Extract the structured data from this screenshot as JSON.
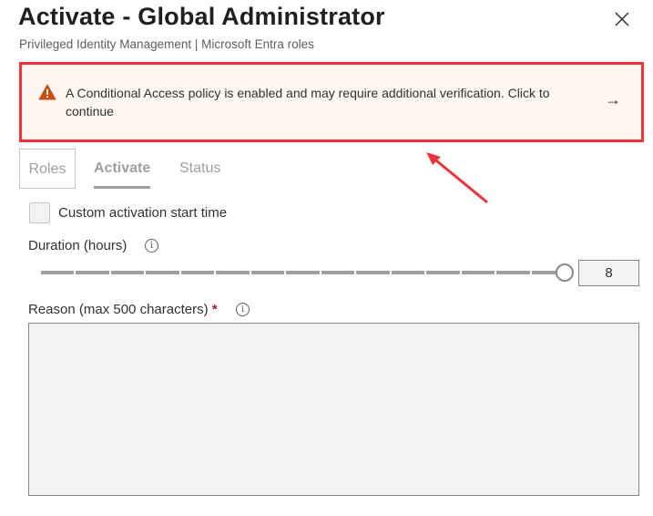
{
  "header": {
    "title": "Activate - Global Administrator",
    "subtitle": "Privileged Identity Management | Microsoft Entra roles"
  },
  "banner": {
    "text": "A Conditional Access policy is enabled and may require additional verification. Click to continue",
    "icon": "warning-icon",
    "color": "#ca5010"
  },
  "tabs": [
    {
      "label": "Roles"
    },
    {
      "label": "Activate"
    },
    {
      "label": "Status"
    }
  ],
  "form": {
    "custom_start_label": "Custom activation start time",
    "custom_start_checked": false,
    "duration_label": "Duration (hours)",
    "duration_value": "8",
    "duration_slider_fraction": 1.0,
    "reason_label": "Reason (max 500 characters)",
    "required_mark": "*",
    "reason_value": ""
  }
}
